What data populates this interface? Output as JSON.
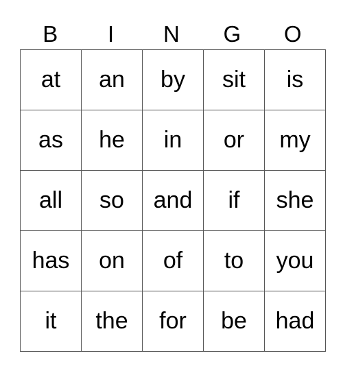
{
  "card": {
    "header": [
      "B",
      "I",
      "N",
      "G",
      "O"
    ],
    "rows": [
      [
        "at",
        "an",
        "by",
        "sit",
        "is"
      ],
      [
        "as",
        "he",
        "in",
        "or",
        "my"
      ],
      [
        "all",
        "so",
        "and",
        "if",
        "she"
      ],
      [
        "has",
        "on",
        "of",
        "to",
        "you"
      ],
      [
        "it",
        "the",
        "for",
        "be",
        "had"
      ]
    ]
  }
}
